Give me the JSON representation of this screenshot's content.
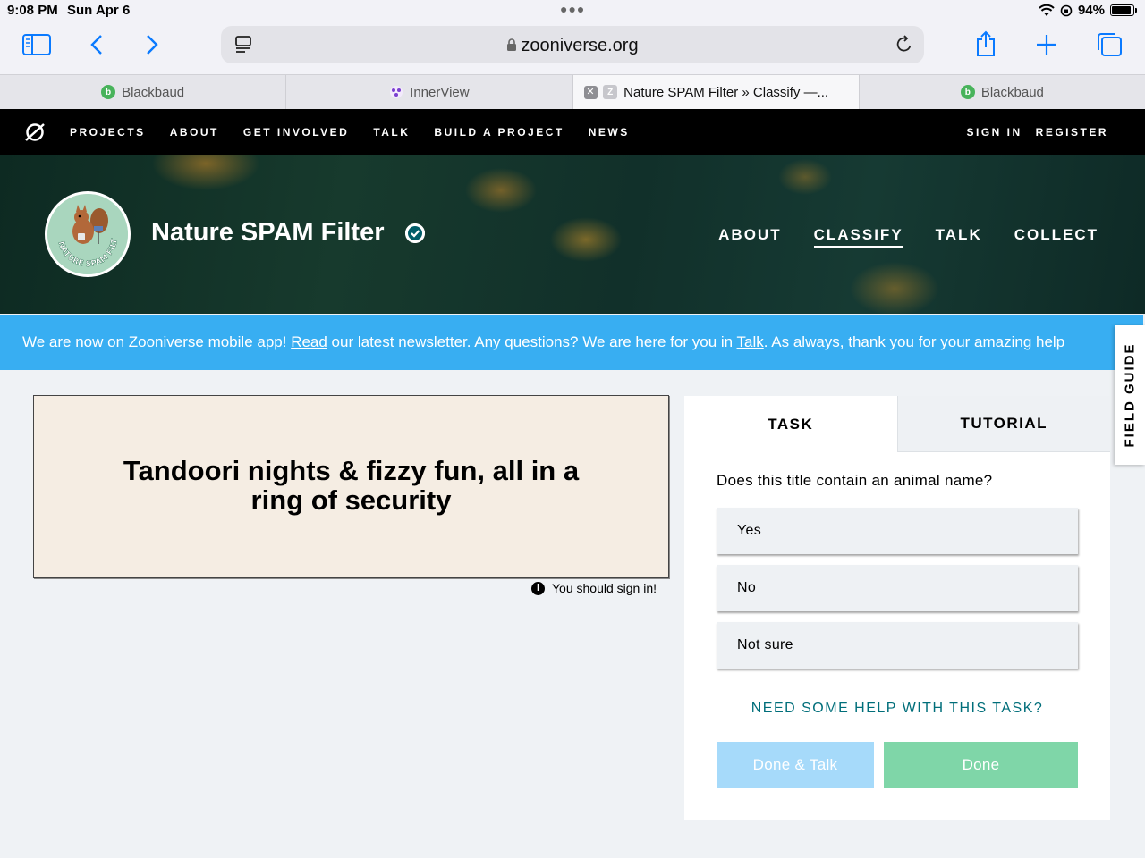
{
  "status": {
    "time": "9:08 PM",
    "date": "Sun Apr 6",
    "battery": "94%"
  },
  "browser": {
    "url": "zooniverse.org",
    "tabs": [
      {
        "label": "Blackbaud"
      },
      {
        "label": "InnerView"
      },
      {
        "label": "Nature SPAM Filter » Classify —..."
      },
      {
        "label": "Blackbaud"
      }
    ]
  },
  "site_nav": {
    "items": [
      "PROJECTS",
      "ABOUT",
      "GET INVOLVED",
      "TALK",
      "BUILD A PROJECT",
      "NEWS"
    ],
    "sign_in": "SIGN IN",
    "register": "REGISTER"
  },
  "project": {
    "title": "Nature SPAM Filter",
    "logo_text": "NATURE SPAM FILTER",
    "nav": [
      "ABOUT",
      "CLASSIFY",
      "TALK",
      "COLLECT"
    ],
    "active_nav": "CLASSIFY"
  },
  "banner": {
    "part1": "We are now on Zooniverse mobile app! ",
    "link1": "Read",
    "part2": " our latest newsletter. Any questions? We are here for you in ",
    "link2": "Talk",
    "part3": ". As always, thank you for your amazing help"
  },
  "field_guide": "FIELD GUIDE",
  "subject": {
    "text_line1": "Tandoori nights & fizzy fun, all in a",
    "text_line2": "ring of security",
    "sign_in_note": "You should sign in!"
  },
  "task_panel": {
    "tabs": [
      "TASK",
      "TUTORIAL"
    ],
    "question": "Does this title contain an animal name?",
    "answers": [
      "Yes",
      "No",
      "Not sure"
    ],
    "help_link": "NEED SOME HELP WITH THIS TASK?",
    "done_talk": "Done & Talk",
    "done": "Done"
  },
  "colors": {
    "banner": "#38aef2",
    "done_talk": "#a6dafa",
    "done": "#7fd6a8",
    "help_link": "#006e7a",
    "safari_accent": "#0a7aff"
  }
}
